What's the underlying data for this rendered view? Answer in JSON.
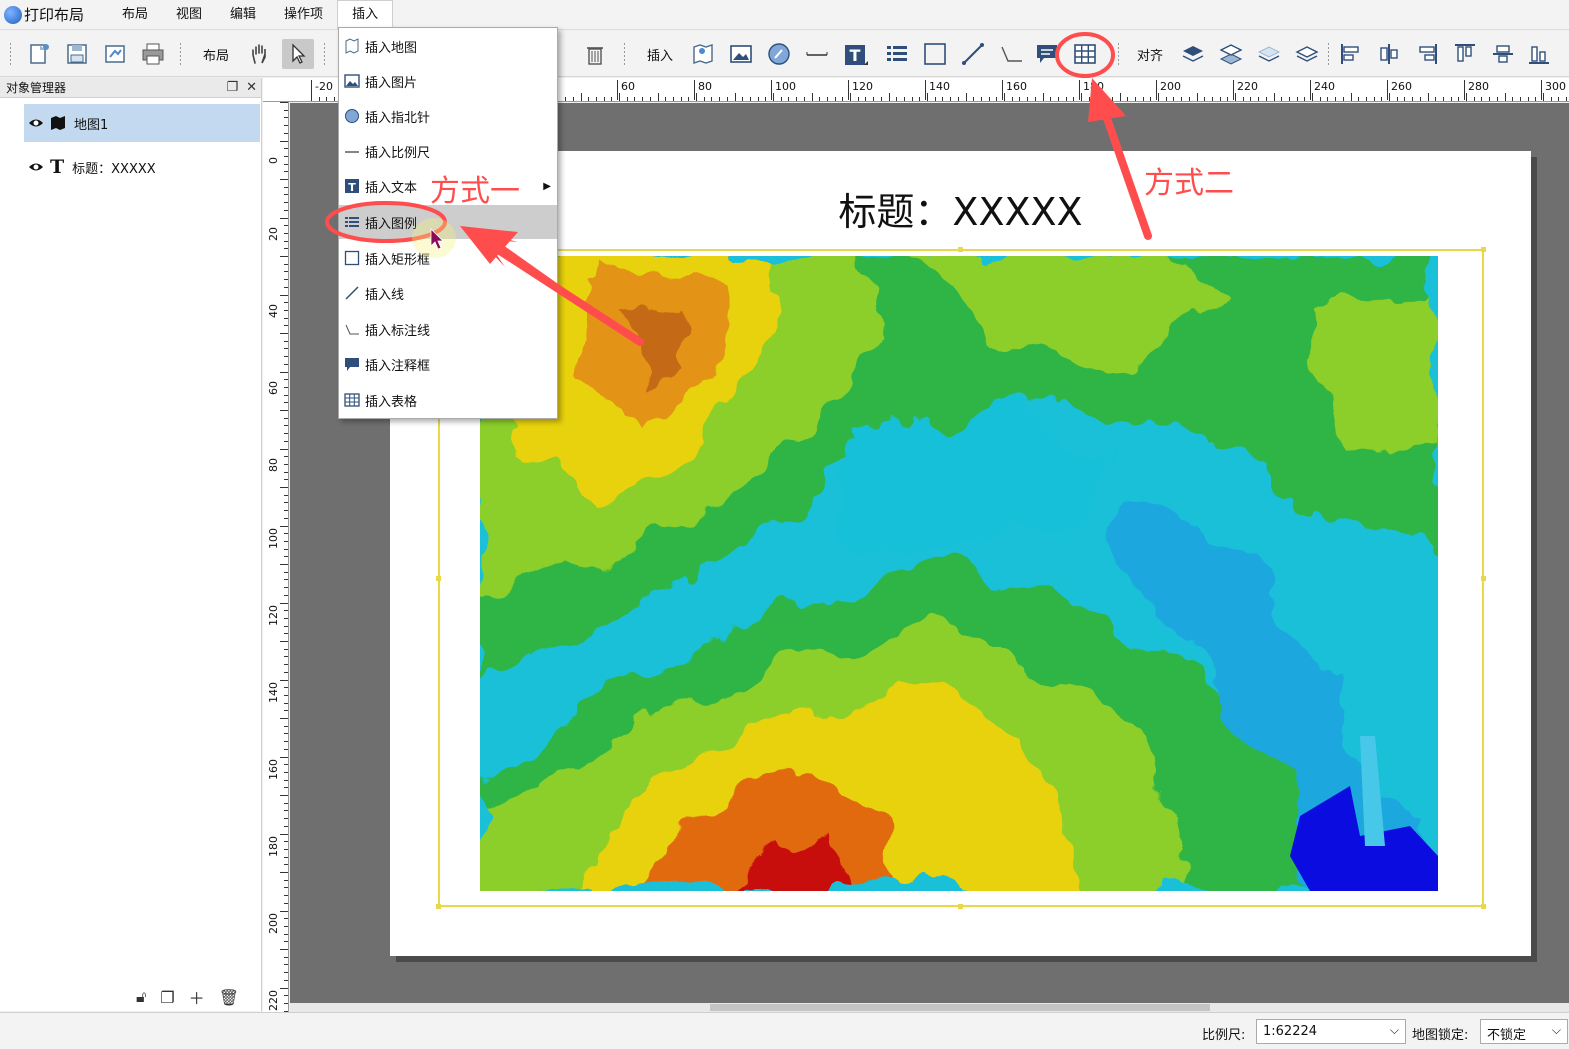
{
  "app": {
    "title": "打印布局"
  },
  "menubar": {
    "items": [
      "布局",
      "视图",
      "编辑",
      "操作项",
      "插入"
    ]
  },
  "toolbar": {
    "layout_label": "布局",
    "insert_label": "插入",
    "align_label": "对齐"
  },
  "insert_menu": {
    "items": [
      {
        "label": "插入地图",
        "icon": "map-icon"
      },
      {
        "label": "插入图片",
        "icon": "picture-icon"
      },
      {
        "label": "插入指北针",
        "icon": "compass-icon"
      },
      {
        "label": "插入比例尺",
        "icon": "scale-bar-icon"
      },
      {
        "label": "插入文本",
        "icon": "text-icon",
        "submenu": true
      },
      {
        "label": "插入图例",
        "icon": "legend-icon",
        "hovered": true
      },
      {
        "label": "插入矩形框",
        "icon": "rectangle-icon"
      },
      {
        "label": "插入线",
        "icon": "line-icon"
      },
      {
        "label": "插入标注线",
        "icon": "leader-line-icon"
      },
      {
        "label": "插入注释框",
        "icon": "callout-icon"
      },
      {
        "label": "插入表格",
        "icon": "table-icon"
      }
    ]
  },
  "object_manager": {
    "title": "对象管理器",
    "items": [
      {
        "label": "地图1",
        "icon": "map-layer-icon",
        "selected": true
      },
      {
        "label": "标题：XXXXX",
        "icon": "text-t-icon",
        "selected": false
      }
    ]
  },
  "ruler": {
    "h_labels": [
      "-20",
      "60",
      "80",
      "100",
      "120",
      "140",
      "160",
      "180",
      "200",
      "220",
      "240",
      "260",
      "280",
      "300"
    ],
    "v_labels": [
      "0",
      "20",
      "40",
      "60",
      "80",
      "100",
      "120",
      "140",
      "160",
      "180",
      "200",
      "220"
    ]
  },
  "layout": {
    "map_title": "标题：XXXXX"
  },
  "status": {
    "scale_label": "比例尺:",
    "scale_value": "1:62224",
    "lock_label": "地图锁定:",
    "lock_value": "不锁定"
  },
  "annotations": {
    "method1": "方式一",
    "method2": "方式二",
    "color": "#ff4d4d"
  }
}
